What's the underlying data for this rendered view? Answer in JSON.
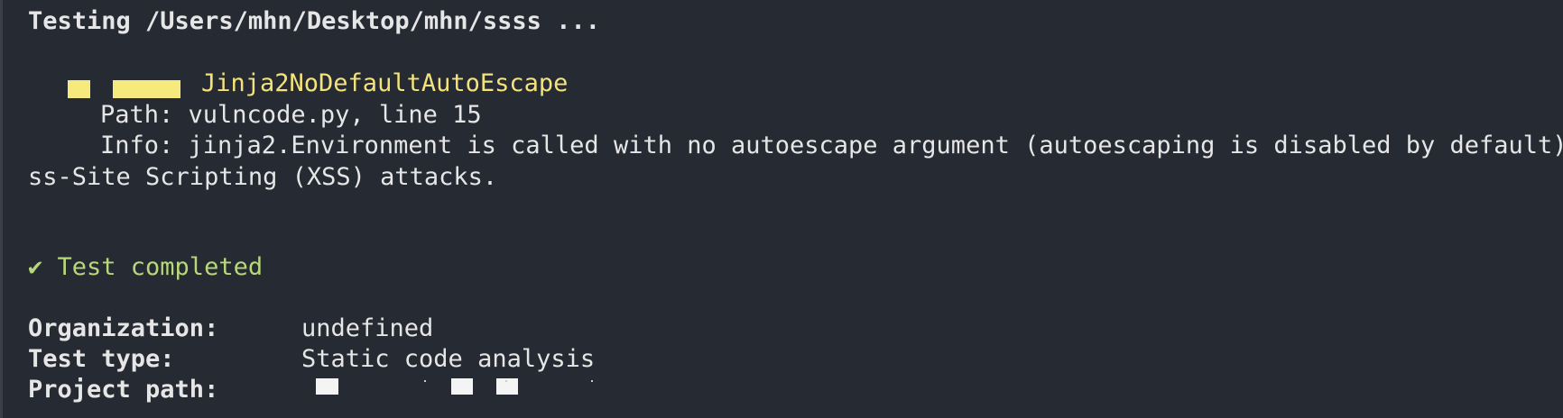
{
  "terminal": {
    "testing_line": "Testing /Users/mhn/Desktop/mhn/ssss ...",
    "issue": {
      "name": "Jinja2NoDefaultAutoEscape",
      "path_line": "Path: vulncode.py, line 15",
      "info_line": "Info: jinja2.Environment is called with no autoescape argument (autoescaping is disabled by default).",
      "info_wrap": "ss-Site Scripting (XSS) attacks."
    },
    "completed": "✔ Test completed",
    "summary": [
      {
        "key": "Organization:",
        "value": "undefined"
      },
      {
        "key": "Test type:",
        "value": "Static code analysis"
      },
      {
        "key": "Project path:",
        "value": ""
      }
    ],
    "colors": {
      "background": "#262a33",
      "text": "#e6e6e6",
      "issue_yellow": "#f3e37a",
      "success_green": "#b7d77a"
    }
  }
}
